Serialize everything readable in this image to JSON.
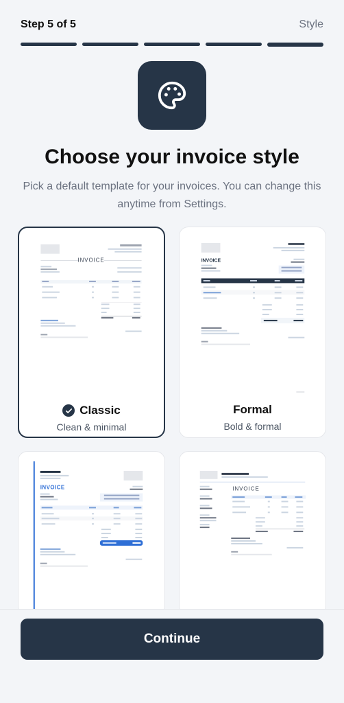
{
  "header": {
    "step": "Step 5 of 5",
    "section": "Style"
  },
  "progress": {
    "total": 5,
    "current": 5
  },
  "title": "Choose your invoice style",
  "subtitle": "Pick a default template for your invoices. You can change this anytime from Settings.",
  "icon": "palette-icon",
  "colors": {
    "primary": "#263547",
    "accent_blue": "#2f6fd6"
  },
  "templates": [
    {
      "name": "Classic",
      "description": "Clean & minimal",
      "selected": true
    },
    {
      "name": "Formal",
      "description": "Bold & formal",
      "selected": false
    },
    {
      "name": "",
      "description": "",
      "selected": false
    },
    {
      "name": "",
      "description": "",
      "selected": false
    }
  ],
  "continue_label": "Continue"
}
